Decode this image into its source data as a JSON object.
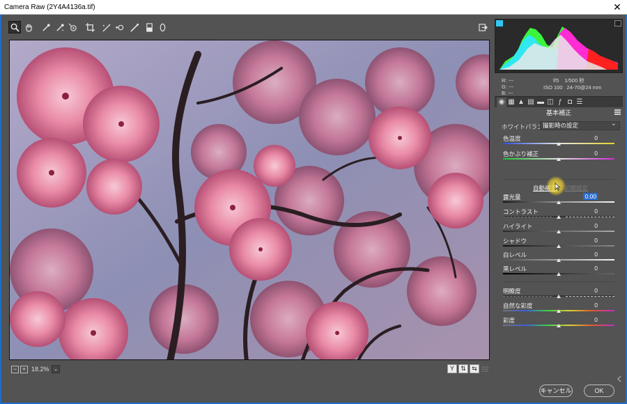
{
  "window": {
    "title": "Camera Raw (2Y4A4136a.tif)",
    "close_glyph": "✕"
  },
  "toolbar": {
    "tools": [
      {
        "name": "zoom-tool-icon",
        "glyph": "🔍"
      },
      {
        "name": "hand-tool-icon",
        "glyph": "✋"
      },
      {
        "name": "white-balance-tool-icon",
        "glyph": "⟋"
      },
      {
        "name": "color-sampler-tool-icon",
        "glyph": "⟋"
      },
      {
        "name": "targeted-adjustment-tool-icon",
        "glyph": "◎"
      },
      {
        "name": "crop-tool-icon",
        "glyph": "⌗"
      },
      {
        "name": "straighten-tool-icon",
        "glyph": "⟋"
      },
      {
        "name": "spot-removal-tool-icon",
        "glyph": "✚"
      },
      {
        "name": "red-eye-tool-icon",
        "glyph": "◉"
      },
      {
        "name": "adjustment-brush-icon",
        "glyph": "⟋"
      },
      {
        "name": "graduated-filter-icon",
        "glyph": "▮"
      },
      {
        "name": "radial-filter-icon",
        "glyph": "◯"
      }
    ],
    "open_preferences_glyph": "⇥"
  },
  "histogram": {
    "colors": {
      "green": "#3cff3c",
      "cyan": "#30e8f0",
      "magenta": "#ff2bd4",
      "red": "#ff2020",
      "white": "#e8e8e8"
    }
  },
  "info": {
    "r": "R:",
    "g": "G:",
    "b": "B:",
    "r_val": "---",
    "g_val": "---",
    "b_val": "---",
    "aperture": "f/5",
    "shutter": "1/500 秒",
    "iso": "ISO 100",
    "lens": "24-70@24 mm"
  },
  "panel": {
    "title": "基本補正",
    "white_balance_label": "ホワイトバランス：",
    "white_balance_value": "撮影時の設定",
    "auto": "自動補正",
    "default": "初期設定",
    "sliders": [
      {
        "name": "temperature",
        "label": "色温度",
        "value": "0"
      },
      {
        "name": "tint",
        "label": "色かぶり補正",
        "value": "0"
      },
      {
        "name": "exposure",
        "label": "露光量",
        "value": "0.00"
      },
      {
        "name": "contrast",
        "label": "コントラスト",
        "value": "0"
      },
      {
        "name": "highlights",
        "label": "ハイライト",
        "value": "0"
      },
      {
        "name": "shadows",
        "label": "シャドウ",
        "value": "0"
      },
      {
        "name": "whites",
        "label": "白レベル",
        "value": "0"
      },
      {
        "name": "blacks",
        "label": "黒レベル",
        "value": "0"
      },
      {
        "name": "clarity",
        "label": "明瞭度",
        "value": "0"
      },
      {
        "name": "vibrance",
        "label": "自然な彩度",
        "value": "0"
      },
      {
        "name": "saturation",
        "label": "彩度",
        "value": "0"
      }
    ]
  },
  "bottom": {
    "zoom_out": "−",
    "zoom_in": "+",
    "zoom": "18.2%",
    "zoom_arrow": "⌄",
    "view_y": "Y",
    "view_compare": "⇅",
    "view_swap": "⇆"
  },
  "footer": {
    "cancel": "キャンセル",
    "ok": "OK"
  }
}
